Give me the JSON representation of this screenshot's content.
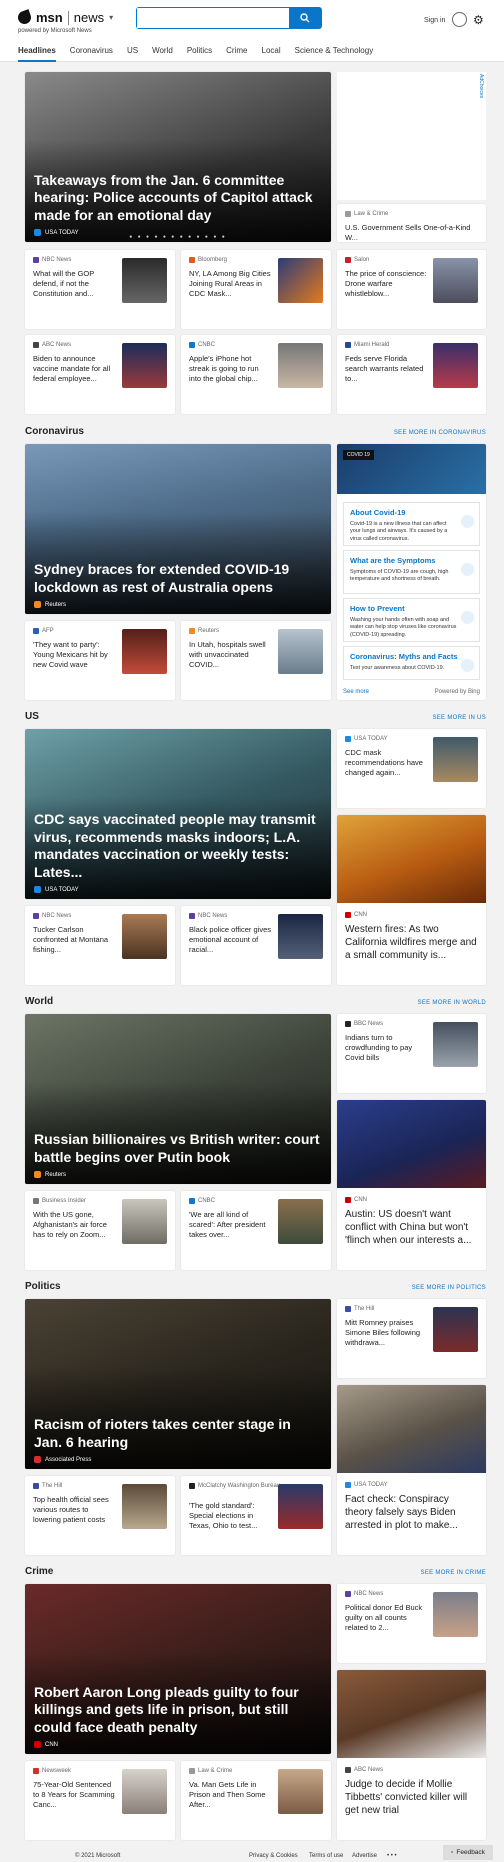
{
  "header": {
    "brand_msn": "msn",
    "brand_news": "news",
    "powered_by": "powered by Microsoft News",
    "search_placeholder": "",
    "sign_in": "Sign in"
  },
  "nav": [
    "Headlines",
    "Coronavirus",
    "US",
    "World",
    "Politics",
    "Crime",
    "Local",
    "Science & Technology"
  ],
  "ad_label": "AdChoices",
  "headlines": {
    "hero": {
      "title": "Takeaways from the Jan. 6 committee hearing: Police accounts of Capitol attack made for an emotional day",
      "source": "USA TODAY",
      "dots": "● ● ● ● ● ● ● ● ● ● ● ●"
    },
    "side": {
      "source": "Law & Crime",
      "title": "U.S. Government Sells One-of-a-Kind W..."
    },
    "row1": [
      {
        "source": "NBC News",
        "title": "What will the GOP defend, if not the Constitution and..."
      },
      {
        "source": "Bloomberg",
        "title": "NY, LA Among Big Cities Joining Rural Areas in CDC Mask..."
      },
      {
        "source": "Salon",
        "title": "The price of conscience: Drone warfare whistleblow..."
      }
    ],
    "row2": [
      {
        "source": "ABC News",
        "title": "Biden to announce vaccine mandate for all federal employee..."
      },
      {
        "source": "CNBC",
        "title": "Apple's iPhone hot streak is going to run into the global chip..."
      },
      {
        "source": "Miami Herald",
        "title": "Feds serve Florida search warrants related to..."
      }
    ]
  },
  "coronavirus": {
    "section": "Coronavirus",
    "more": "SEE MORE IN CORONAVIRUS",
    "hero": {
      "title": "Sydney braces for extended COVID-19 lockdown as rest of Australia opens",
      "source": "Reuters"
    },
    "row": [
      {
        "source": "AFP",
        "title": "'They want to party': Young Mexicans hit by new Covid wave"
      },
      {
        "source": "Reuters",
        "title": "In Utah, hospitals swell with unvaccinated COVID..."
      }
    ],
    "panel": {
      "badge": "COVID 19",
      "items": [
        {
          "h": "About Covid-19",
          "d": "Covid-19 is a new illness that can affect your lungs and airways. It's caused by a virus called coronavirus."
        },
        {
          "h": "What are the Symptoms",
          "d": "Symptoms of COVID-19 are cough, high temperature and shortness of breath."
        },
        {
          "h": "How to Prevent",
          "d": "Washing your hands often with soap and water can help stop viruses like coronavirus (COVID-19) spreading."
        },
        {
          "h": "Coronavirus: Myths and Facts",
          "d": "Test your awareness about COVID-19."
        }
      ],
      "see_more": "See more",
      "powered": "Powered by Bing"
    }
  },
  "us": {
    "section": "US",
    "more": "SEE MORE IN US",
    "hero": {
      "title": "CDC says vaccinated people may transmit virus, recommends masks indoors; L.A. mandates vaccination or weekly tests: Lates...",
      "source": "USA TODAY"
    },
    "side": {
      "source": "USA TODAY",
      "title": "CDC mask recommendations have changed again..."
    },
    "big": {
      "source": "CNN",
      "title": "Western fires: As two California wildfires merge and a small community is..."
    },
    "row": [
      {
        "source": "NBC News",
        "title": "Tucker Carlson confronted at Montana fishing..."
      },
      {
        "source": "NBC News",
        "title": "Black police officer gives emotional account of racial..."
      }
    ]
  },
  "world": {
    "section": "World",
    "more": "SEE MORE IN WORLD",
    "hero": {
      "title": "Russian billionaires vs British writer: court battle begins over Putin book",
      "source": "Reuters"
    },
    "side": {
      "source": "BBC News",
      "title": "Indians turn to crowdfunding to pay Covid bills"
    },
    "big": {
      "source": "CNN",
      "title": "Austin: US doesn't want conflict with China but won't 'flinch when our interests a..."
    },
    "row": [
      {
        "source": "Business Insider",
        "title": "With the US gone, Afghanistan's air force has to rely on Zoom..."
      },
      {
        "source": "CNBC",
        "title": "'We are all kind of scared': After president takes over..."
      }
    ]
  },
  "politics": {
    "section": "Politics",
    "more": "SEE MORE IN POLITICS",
    "hero": {
      "title": "Racism of rioters takes center stage in Jan. 6 hearing",
      "source": "Associated Press"
    },
    "side": {
      "source": "The Hill",
      "title": "Mitt Romney praises Simone Biles following withdrawa..."
    },
    "big": {
      "source": "USA TODAY",
      "title": "Fact check: Conspiracy theory falsely says Biden arrested in plot to make..."
    },
    "row": [
      {
        "source": "The Hill",
        "title": "Top health official sees various routes to lowering patient costs"
      },
      {
        "source": "McClatchy Washington Bureau",
        "title": "'The gold standard': Special elections in Texas, Ohio to test..."
      }
    ]
  },
  "crime": {
    "section": "Crime",
    "more": "SEE MORE IN CRIME",
    "hero": {
      "title": "Robert Aaron Long pleads guilty to four killings and gets life in prison, but still could face death penalty",
      "source": "CNN"
    },
    "side": {
      "source": "NBC News",
      "title": "Political donor Ed Buck guilty on all counts related to 2..."
    },
    "big": {
      "source": "ABC News",
      "title": "Judge to decide if Mollie Tibbetts' convicted killer will get new trial"
    },
    "row": [
      {
        "source": "Newsweek",
        "title": "75-Year-Old Sentenced to 8 Years for Scamming Canc..."
      },
      {
        "source": "Law & Crime",
        "title": "Va. Man Gets Life in Prison and Then Some After..."
      }
    ]
  },
  "footer": {
    "copyright": "© 2021 Microsoft",
    "privacy": "Privacy & Cookies",
    "terms": "Terms of use",
    "advertise": "Advertise",
    "dots": "• • •",
    "feedback": "Feedback"
  }
}
